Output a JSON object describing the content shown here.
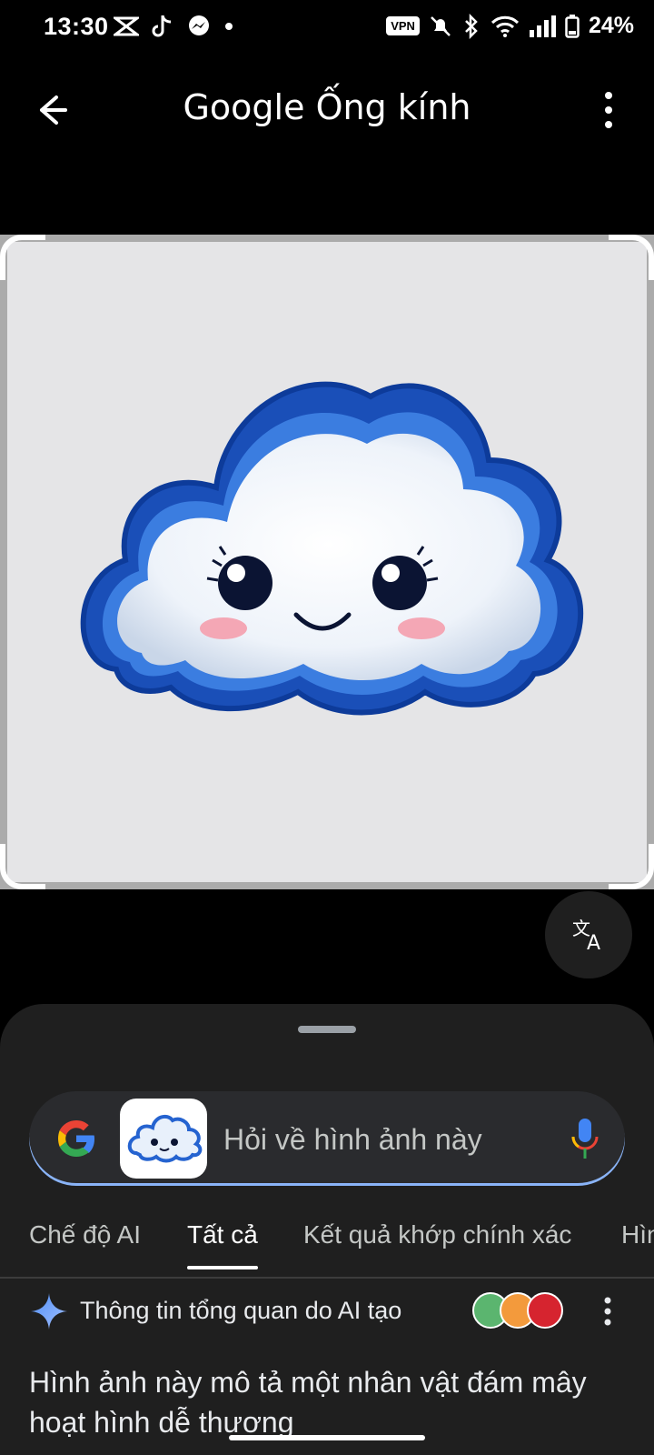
{
  "status_bar": {
    "time": "13:30",
    "vpn": "VPN",
    "battery": "24%"
  },
  "app_bar": {
    "title": "Google Ống kính",
    "back_icon": "arrow-left-icon",
    "more_icon": "more-vert-icon"
  },
  "image": {
    "subject_icon": "cartoon-cloud-image"
  },
  "translate": {
    "icon": "translate-icon"
  },
  "search": {
    "placeholder": "Hỏi về hình ảnh này",
    "logo": "google-g-icon",
    "mic": "mic-icon"
  },
  "tabs": [
    {
      "label": "Chế độ AI"
    },
    {
      "label": "Tất cả"
    },
    {
      "label": "Kết quả khớp chính xác"
    },
    {
      "label": "Hìn"
    }
  ],
  "active_tab": "Tất cả",
  "ai_overview": {
    "title": "Thông tin tổng quan do AI tạo",
    "text": "Hình ảnh này mô tả một nhân vật đám mây hoạt hình dễ thương"
  },
  "colors": {
    "accent": "#8ab4f8",
    "sheet": "#1f1f1f",
    "cloud_outline": "#1f5fc8"
  }
}
